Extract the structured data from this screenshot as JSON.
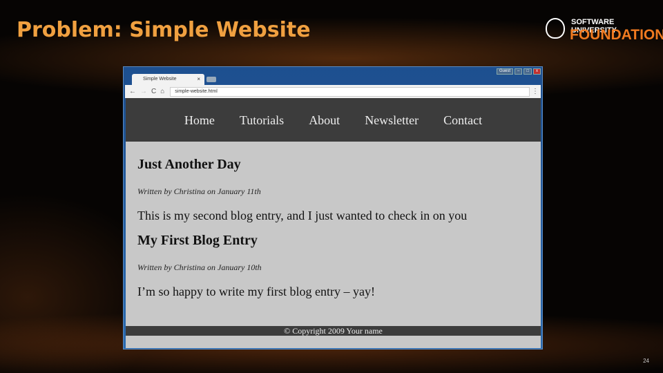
{
  "slide": {
    "title": "Problem: Simple Website",
    "page_number": "24"
  },
  "logo": {
    "line1": "SOFTWARE UNIVERSITY",
    "line2": "FOUNDATION"
  },
  "browser": {
    "tab_title": "Simple Website",
    "tab_close": "×",
    "url": "simple-website.html",
    "guest": "Guest",
    "min": "–",
    "max": "□",
    "close": "x",
    "back": "←",
    "forward": "→",
    "reload": "C",
    "home": "⌂",
    "search": "🔍",
    "menu": "⋮"
  },
  "site": {
    "nav": [
      "Home",
      "Tutorials",
      "About",
      "Newsletter",
      "Contact"
    ],
    "posts": [
      {
        "title": "Just Another Day",
        "byline": "Written by Christina on January 11th",
        "text": "This is my second blog entry, and I just wanted to check in on you"
      },
      {
        "title": "My First Blog Entry",
        "byline": "Written by Christina on January 10th",
        "text": "I’m so happy to write my first blog entry – yay!"
      }
    ],
    "footer": "© Copyright 2009 Your name"
  }
}
